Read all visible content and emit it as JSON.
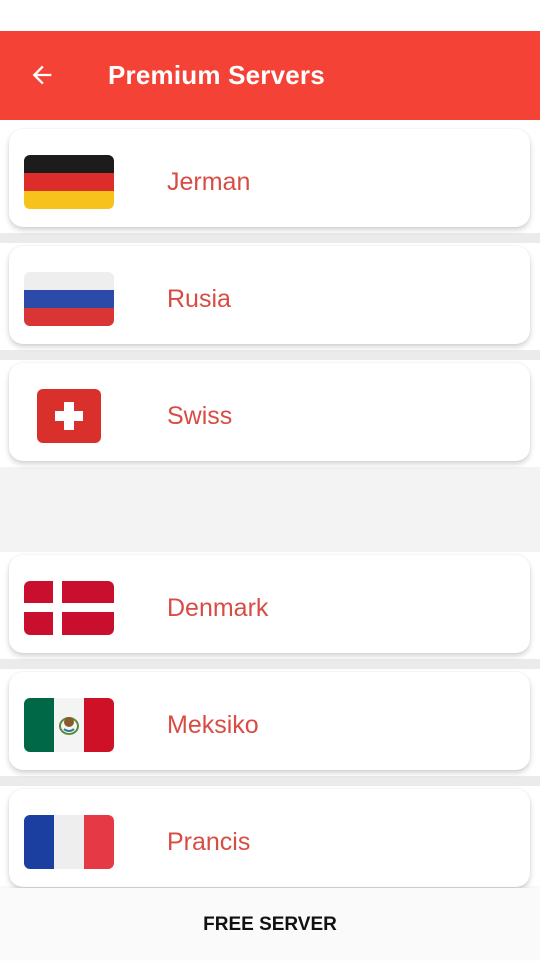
{
  "app_bar": {
    "title": "Premium Servers",
    "back_icon": "arrow-left-icon",
    "background": "#f44336"
  },
  "servers": [
    {
      "name": "Jerman",
      "flag_icon": "germany-flag-icon"
    },
    {
      "name": "Rusia",
      "flag_icon": "russia-flag-icon"
    },
    {
      "name": "Swiss",
      "flag_icon": "switzerland-flag-icon"
    },
    {
      "name": "Denmark",
      "flag_icon": "denmark-flag-icon"
    },
    {
      "name": "Meksiko",
      "flag_icon": "mexico-flag-icon"
    },
    {
      "name": "Prancis",
      "flag_icon": "france-flag-icon"
    }
  ],
  "bottom_nav": {
    "free_server_label": "FREE SERVER"
  },
  "colors": {
    "accent": "#f44336",
    "country_text": "#d84c44"
  }
}
